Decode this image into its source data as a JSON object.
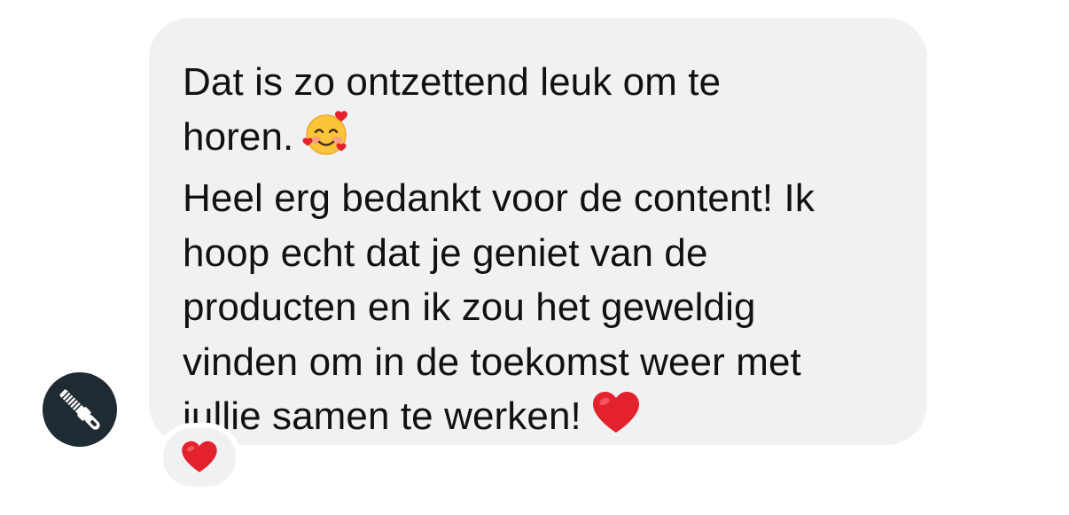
{
  "message": {
    "lines": [
      "Dat is zo ontzettend leuk om te",
      "horen.",
      "Heel erg bedankt voor de content! Ik",
      "hoop echt dat je geniet van de",
      "producten en ik zou het geweldig",
      "vinden om in de toekomst weer met",
      "jullie samen te werken!"
    ],
    "emojis": [
      "smiling-face-with-hearts",
      "red-heart"
    ]
  },
  "reaction": {
    "emoji": "red-heart"
  },
  "avatar": {
    "icon": "zipper-pull-icon",
    "background": "#1f2b33"
  },
  "colors": {
    "bubble": "#f0f1f3",
    "text": "#111111",
    "heart": "#e3222d"
  }
}
